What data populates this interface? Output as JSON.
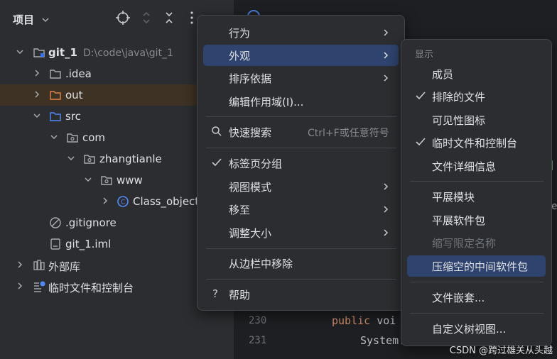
{
  "project_panel": {
    "title": "项目",
    "tree": [
      {
        "label": "git_1",
        "path": "D:\\code\\java\\git_1"
      },
      {
        "label": ".idea"
      },
      {
        "label": "out"
      },
      {
        "label": "src"
      },
      {
        "label": "com"
      },
      {
        "label": "zhangtianle"
      },
      {
        "label": "www"
      },
      {
        "label": "Class_object"
      },
      {
        "label": ".gitignore"
      },
      {
        "label": "git_1.iml"
      },
      {
        "label": "外部库"
      },
      {
        "label": "临时文件和控制台"
      }
    ]
  },
  "editor": {
    "lines": [
      {
        "num": "230",
        "kw": "public",
        "text": " voi"
      },
      {
        "num": "231",
        "kw": "",
        "text": "System."
      }
    ]
  },
  "context_menu": {
    "items": [
      {
        "label": "行为"
      },
      {
        "label": "外观"
      },
      {
        "label": "排序依据"
      },
      {
        "label": "编辑作用域(I)..."
      },
      {
        "label": "快速搜索",
        "shortcut": "Ctrl+F或任意符号"
      },
      {
        "label": "标签页分组"
      },
      {
        "label": "视图模式"
      },
      {
        "label": "移至"
      },
      {
        "label": "调整大小"
      },
      {
        "label": "从边栏中移除"
      },
      {
        "label": "帮助"
      }
    ]
  },
  "submenu": {
    "section": "显示",
    "items": [
      {
        "label": "成员"
      },
      {
        "label": "排除的文件"
      },
      {
        "label": "可见性图标"
      },
      {
        "label": "临时文件和控制台"
      },
      {
        "label": "文件详细信息"
      },
      {
        "label": "平展模块"
      },
      {
        "label": "平展软件包"
      },
      {
        "label": "缩写限定名称"
      },
      {
        "label": "压缩空的中间软件包"
      },
      {
        "label": "文件嵌套..."
      },
      {
        "label": "自定义树视图..."
      }
    ]
  },
  "watermark": "CSDN @跨过雄关从头越",
  "colors": {
    "accent": "#2e436e",
    "panel": "#2b2d30",
    "selected_row": "#3d3224"
  }
}
